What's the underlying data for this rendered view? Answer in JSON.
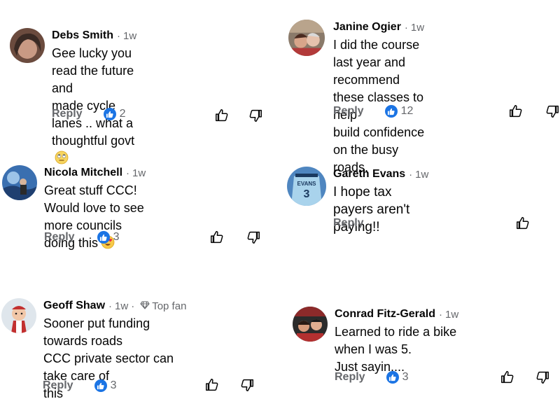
{
  "comments": [
    {
      "name": "Debs Smith",
      "time": "1w",
      "badge": "",
      "text": "Gee lucky you read the future and\nmade cycle lanes .. what a\nthoughtful govt",
      "emoji": "eye-roll-emoji",
      "reply_label": "Reply",
      "likes": "2"
    },
    {
      "name": "Janine Ogier",
      "time": "1w",
      "badge": "",
      "text": "I did the course last year and\nrecommend these classes to help\nbuild confidence on the busy roads.",
      "emoji": "",
      "reply_label": "Reply",
      "likes": "12"
    },
    {
      "name": "Nicola Mitchell",
      "time": "1w",
      "badge": "",
      "text": "Great stuff CCC! Would love to see\nmore councils doing this",
      "emoji": "heart-eyes-emoji",
      "reply_label": "Reply",
      "likes": "3"
    },
    {
      "name": "Gareth Evans",
      "time": "1w",
      "badge": "",
      "text": "I hope tax payers aren't paying!!",
      "emoji": "",
      "reply_label": "Reply",
      "likes": ""
    },
    {
      "name": "Geoff Shaw",
      "time": "1w",
      "badge": "Top fan",
      "text": "Sooner put funding towards roads\nCCC private sector can take care of\nthis",
      "emoji": "",
      "reply_label": "Reply",
      "likes": "3"
    },
    {
      "name": "Conrad Fitz-Gerald",
      "time": "1w",
      "badge": "",
      "text": "Learned to ride a bike when I was 5.\nJust sayin....",
      "emoji": "",
      "reply_label": "Reply",
      "likes": "3"
    }
  ],
  "avatar_texts": {
    "gareth_jersey": "EVANS",
    "gareth_number": "3"
  },
  "separator": "·",
  "colors": {
    "like_blue": "#1b74e4",
    "meta_gray": "#65676b",
    "text": "#050505"
  }
}
